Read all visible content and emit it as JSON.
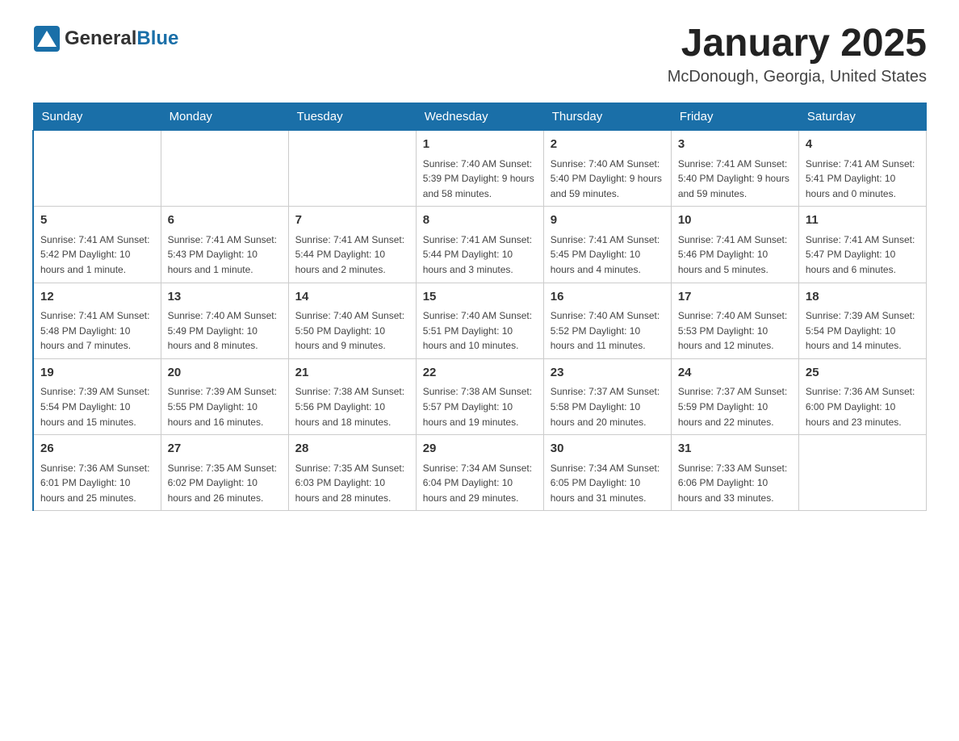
{
  "header": {
    "logo_general": "General",
    "logo_blue": "Blue",
    "month_title": "January 2025",
    "location": "McDonough, Georgia, United States"
  },
  "weekdays": [
    "Sunday",
    "Monday",
    "Tuesday",
    "Wednesday",
    "Thursday",
    "Friday",
    "Saturday"
  ],
  "weeks": [
    [
      {
        "day": "",
        "info": ""
      },
      {
        "day": "",
        "info": ""
      },
      {
        "day": "",
        "info": ""
      },
      {
        "day": "1",
        "info": "Sunrise: 7:40 AM\nSunset: 5:39 PM\nDaylight: 9 hours\nand 58 minutes."
      },
      {
        "day": "2",
        "info": "Sunrise: 7:40 AM\nSunset: 5:40 PM\nDaylight: 9 hours\nand 59 minutes."
      },
      {
        "day": "3",
        "info": "Sunrise: 7:41 AM\nSunset: 5:40 PM\nDaylight: 9 hours\nand 59 minutes."
      },
      {
        "day": "4",
        "info": "Sunrise: 7:41 AM\nSunset: 5:41 PM\nDaylight: 10 hours\nand 0 minutes."
      }
    ],
    [
      {
        "day": "5",
        "info": "Sunrise: 7:41 AM\nSunset: 5:42 PM\nDaylight: 10 hours\nand 1 minute."
      },
      {
        "day": "6",
        "info": "Sunrise: 7:41 AM\nSunset: 5:43 PM\nDaylight: 10 hours\nand 1 minute."
      },
      {
        "day": "7",
        "info": "Sunrise: 7:41 AM\nSunset: 5:44 PM\nDaylight: 10 hours\nand 2 minutes."
      },
      {
        "day": "8",
        "info": "Sunrise: 7:41 AM\nSunset: 5:44 PM\nDaylight: 10 hours\nand 3 minutes."
      },
      {
        "day": "9",
        "info": "Sunrise: 7:41 AM\nSunset: 5:45 PM\nDaylight: 10 hours\nand 4 minutes."
      },
      {
        "day": "10",
        "info": "Sunrise: 7:41 AM\nSunset: 5:46 PM\nDaylight: 10 hours\nand 5 minutes."
      },
      {
        "day": "11",
        "info": "Sunrise: 7:41 AM\nSunset: 5:47 PM\nDaylight: 10 hours\nand 6 minutes."
      }
    ],
    [
      {
        "day": "12",
        "info": "Sunrise: 7:41 AM\nSunset: 5:48 PM\nDaylight: 10 hours\nand 7 minutes."
      },
      {
        "day": "13",
        "info": "Sunrise: 7:40 AM\nSunset: 5:49 PM\nDaylight: 10 hours\nand 8 minutes."
      },
      {
        "day": "14",
        "info": "Sunrise: 7:40 AM\nSunset: 5:50 PM\nDaylight: 10 hours\nand 9 minutes."
      },
      {
        "day": "15",
        "info": "Sunrise: 7:40 AM\nSunset: 5:51 PM\nDaylight: 10 hours\nand 10 minutes."
      },
      {
        "day": "16",
        "info": "Sunrise: 7:40 AM\nSunset: 5:52 PM\nDaylight: 10 hours\nand 11 minutes."
      },
      {
        "day": "17",
        "info": "Sunrise: 7:40 AM\nSunset: 5:53 PM\nDaylight: 10 hours\nand 12 minutes."
      },
      {
        "day": "18",
        "info": "Sunrise: 7:39 AM\nSunset: 5:54 PM\nDaylight: 10 hours\nand 14 minutes."
      }
    ],
    [
      {
        "day": "19",
        "info": "Sunrise: 7:39 AM\nSunset: 5:54 PM\nDaylight: 10 hours\nand 15 minutes."
      },
      {
        "day": "20",
        "info": "Sunrise: 7:39 AM\nSunset: 5:55 PM\nDaylight: 10 hours\nand 16 minutes."
      },
      {
        "day": "21",
        "info": "Sunrise: 7:38 AM\nSunset: 5:56 PM\nDaylight: 10 hours\nand 18 minutes."
      },
      {
        "day": "22",
        "info": "Sunrise: 7:38 AM\nSunset: 5:57 PM\nDaylight: 10 hours\nand 19 minutes."
      },
      {
        "day": "23",
        "info": "Sunrise: 7:37 AM\nSunset: 5:58 PM\nDaylight: 10 hours\nand 20 minutes."
      },
      {
        "day": "24",
        "info": "Sunrise: 7:37 AM\nSunset: 5:59 PM\nDaylight: 10 hours\nand 22 minutes."
      },
      {
        "day": "25",
        "info": "Sunrise: 7:36 AM\nSunset: 6:00 PM\nDaylight: 10 hours\nand 23 minutes."
      }
    ],
    [
      {
        "day": "26",
        "info": "Sunrise: 7:36 AM\nSunset: 6:01 PM\nDaylight: 10 hours\nand 25 minutes."
      },
      {
        "day": "27",
        "info": "Sunrise: 7:35 AM\nSunset: 6:02 PM\nDaylight: 10 hours\nand 26 minutes."
      },
      {
        "day": "28",
        "info": "Sunrise: 7:35 AM\nSunset: 6:03 PM\nDaylight: 10 hours\nand 28 minutes."
      },
      {
        "day": "29",
        "info": "Sunrise: 7:34 AM\nSunset: 6:04 PM\nDaylight: 10 hours\nand 29 minutes."
      },
      {
        "day": "30",
        "info": "Sunrise: 7:34 AM\nSunset: 6:05 PM\nDaylight: 10 hours\nand 31 minutes."
      },
      {
        "day": "31",
        "info": "Sunrise: 7:33 AM\nSunset: 6:06 PM\nDaylight: 10 hours\nand 33 minutes."
      },
      {
        "day": "",
        "info": ""
      }
    ]
  ]
}
